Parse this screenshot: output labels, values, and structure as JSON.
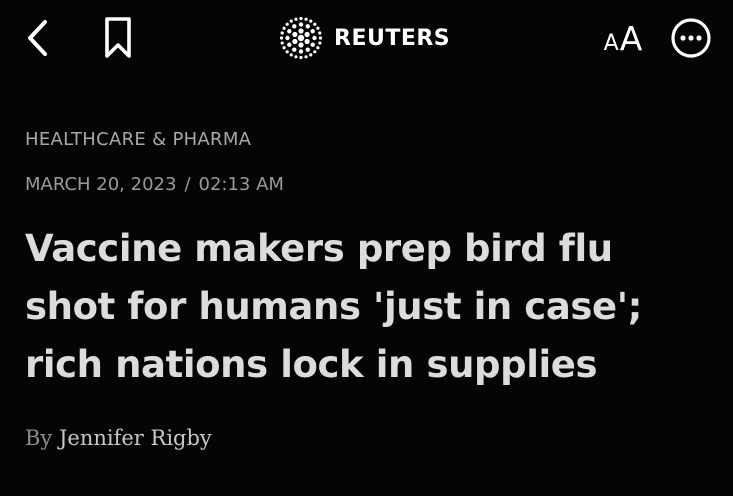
{
  "header": {
    "back_icon": "chevron-left-icon",
    "bookmark_icon": "bookmark-icon",
    "brand_logo_icon": "reuters-dot-logo-icon",
    "brand_name": "REUTERS",
    "text_size_small": "A",
    "text_size_large": "A",
    "more_icon": "more-circle-icon"
  },
  "article": {
    "section": "HEALTHCARE & PHARMA",
    "date": "MARCH 20, 2023",
    "date_separator": "/",
    "time": "02:13 AM",
    "headline": "Vaccine makers prep bird flu shot for humans 'just in case'; rich nations lock in supplies",
    "byline_prefix": "By",
    "author": "Jennifer Rigby"
  },
  "colors": {
    "background": "#050505",
    "primary_text": "#dcdcdc",
    "secondary_text": "#a8a8a8"
  }
}
